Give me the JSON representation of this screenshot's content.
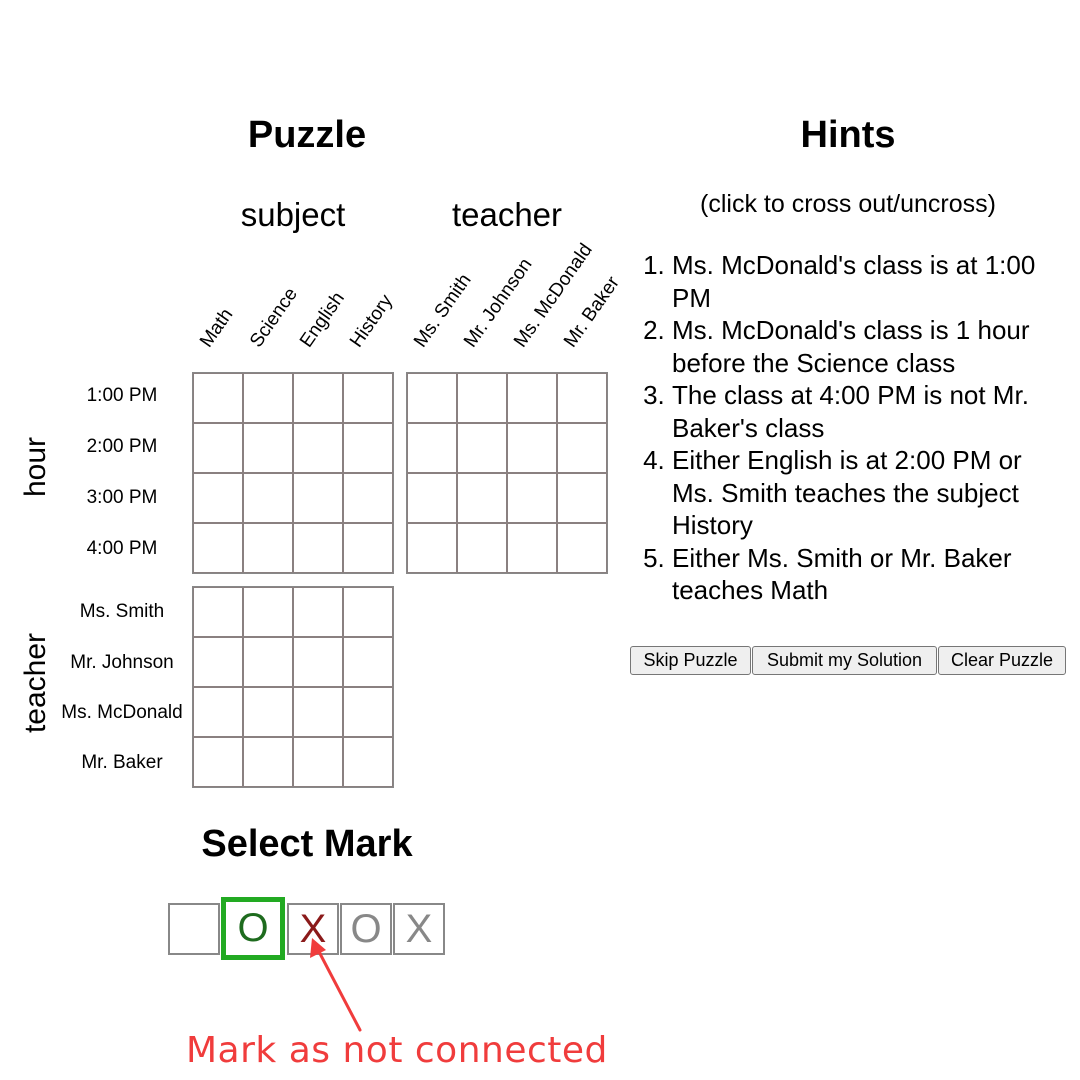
{
  "puzzle": {
    "title": "Puzzle",
    "column_groups": [
      {
        "label": "subject",
        "items": [
          "Math",
          "Science",
          "English",
          "History"
        ]
      },
      {
        "label": "teacher",
        "items": [
          "Ms. Smith",
          "Mr. Johnson",
          "Ms. McDonald",
          "Mr. Baker"
        ]
      }
    ],
    "row_groups": [
      {
        "label": "hour",
        "items": [
          "1:00 PM",
          "2:00 PM",
          "3:00 PM",
          "4:00 PM"
        ]
      },
      {
        "label": "teacher",
        "items": [
          "Ms. Smith",
          "Mr. Johnson",
          "Ms. McDonald",
          "Mr. Baker"
        ]
      }
    ]
  },
  "hints": {
    "title": "Hints",
    "subtitle": "(click to cross out/uncross)",
    "items": [
      "Ms. McDonald's class is at 1:00 PM",
      "Ms. McDonald's class is 1 hour before the Science class",
      "The class at 4:00 PM is not Mr. Baker's class",
      "Either English is at 2:00 PM or Ms. Smith teaches the subject History",
      "Either Ms. Smith or Mr. Baker teaches Math"
    ]
  },
  "buttons": {
    "skip": "Skip Puzzle",
    "submit": "Submit my Solution",
    "clear": "Clear Puzzle"
  },
  "select_mark": {
    "title": "Select Mark",
    "marks": [
      {
        "symbol": "",
        "color": "#000000",
        "selected": false
      },
      {
        "symbol": "O",
        "color": "#1e6b1e",
        "selected": true
      },
      {
        "symbol": "X",
        "color": "#8b1a1a",
        "selected": false
      },
      {
        "symbol": "O",
        "color": "#888888",
        "selected": false
      },
      {
        "symbol": "X",
        "color": "#888888",
        "selected": false
      }
    ],
    "selected_border_color": "#22aa22"
  },
  "annotation": {
    "text": "Mark as not connected",
    "color": "#f03c3c"
  }
}
